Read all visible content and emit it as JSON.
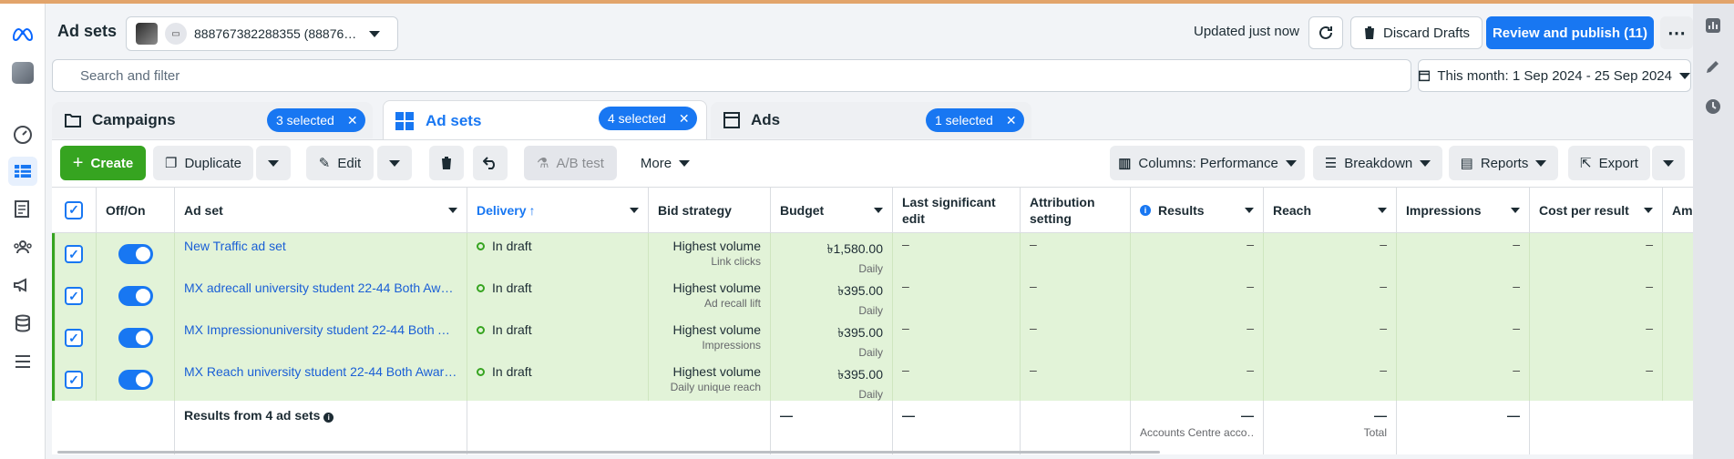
{
  "header": {
    "title": "Ad sets",
    "account": "888767382288355 (88876…",
    "updated": "Updated just now",
    "discard_label": "Discard Drafts",
    "review_label": "Review and publish (11)",
    "more_icon": "more-icon"
  },
  "search": {
    "placeholder": "Search and filter"
  },
  "date_range": "This month: 1 Sep 2024 - 25 Sep 2024",
  "tabs": [
    {
      "label": "Campaigns",
      "chip": "3 selected"
    },
    {
      "label": "Ad sets",
      "chip": "4 selected"
    },
    {
      "label": "Ads",
      "chip": "1 selected"
    }
  ],
  "toolbar": {
    "create": "Create",
    "duplicate": "Duplicate",
    "edit": "Edit",
    "ab_test": "A/B test",
    "more": "More",
    "columns": "Columns: Performance",
    "breakdown": "Breakdown",
    "reports": "Reports",
    "export": "Export"
  },
  "columns": {
    "offon": "Off/On",
    "adset": "Ad set",
    "delivery": "Delivery",
    "bid": "Bid strategy",
    "budget": "Budget",
    "last_edit_1": "Last significant",
    "last_edit_2": "edit",
    "attribution_1": "Attribution",
    "attribution_2": "setting",
    "results": "Results",
    "reach": "Reach",
    "impressions": "Impressions",
    "cost": "Cost per result",
    "amount": "Am"
  },
  "rows": [
    {
      "name": "New Traffic ad set",
      "delivery": "In draft",
      "bid": "Highest volume",
      "bid_sub": "Link clicks",
      "budget": "৳1,580.00",
      "budget_sub": "Daily",
      "dash": "–"
    },
    {
      "name": "MX adrecall university student 22-44 Both Awa…",
      "delivery": "In draft",
      "bid": "Highest volume",
      "bid_sub": "Ad recall lift",
      "budget": "৳395.00",
      "budget_sub": "Daily",
      "dash": "–"
    },
    {
      "name": "MX Impressionuniversity student 22-44 Both A…",
      "delivery": "In draft",
      "bid": "Highest volume",
      "bid_sub": "Impressions",
      "budget": "৳395.00",
      "budget_sub": "Daily",
      "dash": "–"
    },
    {
      "name": "MX Reach university student 22-44 Both Aware…",
      "delivery": "In draft",
      "bid": "Highest volume",
      "bid_sub": "Daily unique reach",
      "budget": "৳395.00",
      "budget_sub": "Daily",
      "dash": "–"
    }
  ],
  "summary": {
    "label": "Results from 4 ad sets",
    "dash": "—",
    "reach_sub": "Accounts Centre acco…",
    "impressions_sub": "Total"
  },
  "colors": {
    "accent": "#1877f2",
    "create": "#36a420",
    "row_selected": "#e2f3d8"
  }
}
